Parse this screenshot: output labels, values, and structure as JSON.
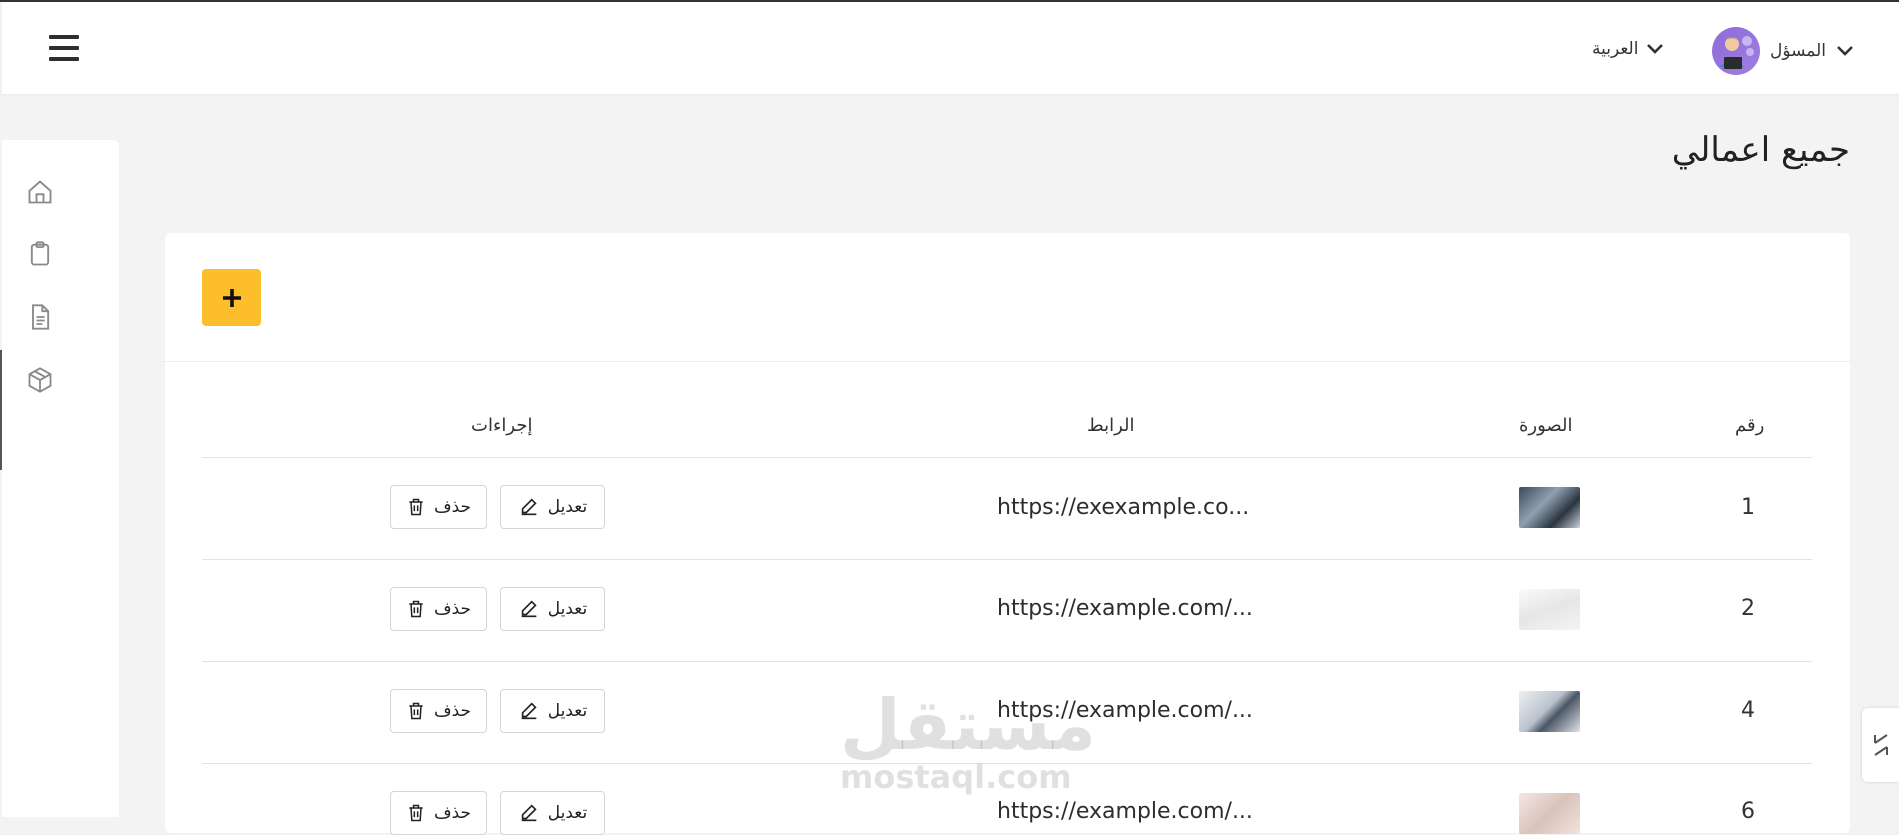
{
  "header": {
    "language_label": "العربية",
    "user_label": "المسؤل"
  },
  "sidebar": {
    "items": [
      {
        "icon": "home-icon"
      },
      {
        "icon": "clipboard-icon"
      },
      {
        "icon": "document-icon"
      },
      {
        "icon": "box-icon"
      }
    ]
  },
  "page": {
    "title": "جميع اعمالي",
    "add_label": "+"
  },
  "table": {
    "headers": {
      "number": "رقم",
      "image": "الصورة",
      "link": "الرابط",
      "actions": "إجراءات"
    },
    "edit_label": "تعديل",
    "delete_label": "حذف",
    "rows": [
      {
        "number": "1",
        "link": "https://exexample.co...",
        "thumb": "thumb-dark"
      },
      {
        "number": "2",
        "link": "https://example.com/...",
        "thumb": "thumb-light"
      },
      {
        "number": "4",
        "link": "https://example.com/...",
        "thumb": "thumb-desk"
      },
      {
        "number": "6",
        "link": "https://example.com/...",
        "thumb": "thumb-pink"
      }
    ]
  },
  "watermark": {
    "arabic": "مستقل",
    "latin": "mostaql.com"
  },
  "colors": {
    "accent": "#fdbe2c",
    "background": "#f3f3f4",
    "avatar": "#8e6bd8"
  }
}
